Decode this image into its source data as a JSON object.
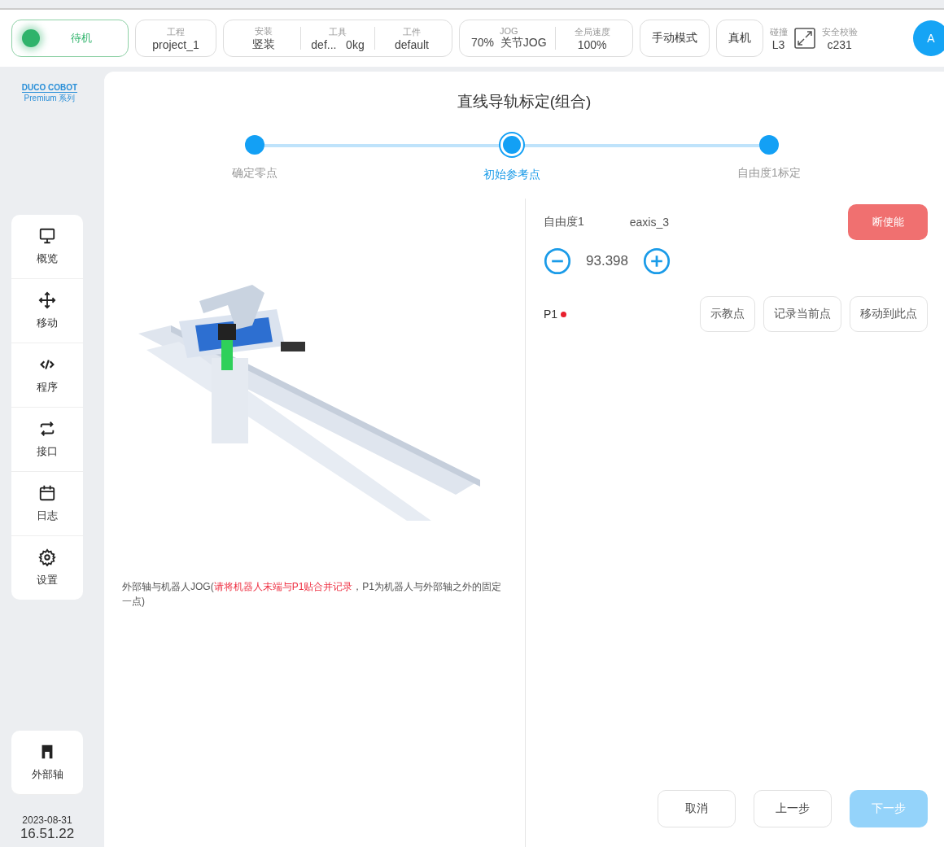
{
  "top_bar": {
    "status": {
      "label": "待机",
      "color": "#2fb36b"
    },
    "groups": [
      {
        "fields": [
          {
            "label": "工程",
            "value": "project_1"
          }
        ]
      },
      {
        "fields": [
          {
            "label": "安装",
            "value": "竖装"
          },
          {
            "label": "工具",
            "value": "def...   0kg"
          },
          {
            "label": "工件",
            "value": "default"
          }
        ]
      },
      {
        "fields": [
          {
            "label": "JOG",
            "value": "70%  关节JOG"
          },
          {
            "label": "全局速度",
            "value": "100%"
          }
        ]
      }
    ],
    "mode_buttons": [
      "手动模式",
      "真机"
    ],
    "collision": {
      "label": "碰撞",
      "value": "L3"
    },
    "safety": {
      "label": "安全校验",
      "value": "c231"
    },
    "avatar": "A"
  },
  "sidebar": {
    "logo": "DUCO COBOT",
    "logo_sub": "Premium 系列",
    "items": [
      {
        "kind": "monitor",
        "label": "概览",
        "selected": false
      },
      {
        "kind": "move",
        "label": "移动",
        "selected": false
      },
      {
        "kind": "code",
        "label": "程序",
        "selected": false
      },
      {
        "kind": "swap",
        "label": "接口",
        "selected": false
      },
      {
        "kind": "calendar",
        "label": "日志",
        "selected": false
      },
      {
        "kind": "gear",
        "label": "设置",
        "selected": false
      }
    ],
    "extra": {
      "label": "外部轴"
    },
    "date": "2023-08-31",
    "time": "16.51.22"
  },
  "main": {
    "title": "直线导轨标定(组合)",
    "steps": [
      {
        "label": "确定零点",
        "selected": false
      },
      {
        "label": "初始参考点",
        "selected": true
      },
      {
        "label": "自由度1标定",
        "selected": false
      }
    ],
    "note": [
      {
        "kind": "normal",
        "text": "外部轴与机器人JOG("
      },
      {
        "kind": "warning",
        "text": "请将机器人末端与P1贴合并记录"
      },
      {
        "kind": "normal",
        "text": "，P1为机器人与外部轴之外的固定一点)"
      }
    ],
    "axis": {
      "label": "自由度1",
      "name": "eaxis_3",
      "value": "93.398",
      "disable_button": "断使能"
    },
    "point": {
      "name": "P1",
      "color": "#e8202e",
      "buttons": [
        "示教点",
        "记录当前点",
        "移动到此点"
      ]
    },
    "footer": [
      {
        "label": "取消",
        "kind": "plain",
        "disabled": false
      },
      {
        "label": "上一步",
        "kind": "plain",
        "disabled": false
      },
      {
        "label": "下一步",
        "kind": "primary",
        "disabled": true
      }
    ]
  }
}
